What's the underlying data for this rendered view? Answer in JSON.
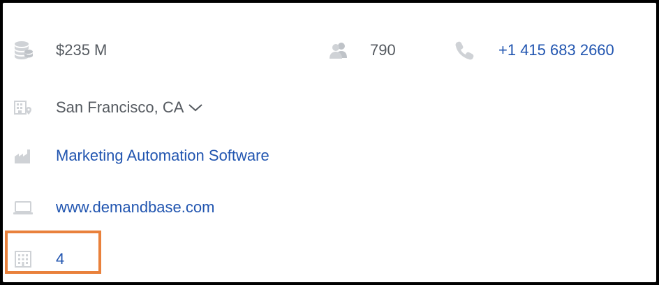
{
  "company": {
    "revenue": {
      "icon": "coins-stack-icon",
      "value": "$235 M"
    },
    "employees": {
      "icon": "people-icon",
      "value": "790"
    },
    "phone": {
      "icon": "phone-icon",
      "value": "+1 415 683 2660"
    },
    "location": {
      "icon": "building-map-pin-icon",
      "value": "San Francisco, CA"
    },
    "industry": {
      "icon": "factory-icon",
      "value": "Marketing Automation Software"
    },
    "website": {
      "icon": "laptop-icon",
      "value": "www.demandbase.com"
    },
    "offices": {
      "icon": "office-building-icon",
      "value": "4"
    }
  },
  "colors": {
    "icon_gray": "#cfd2d6",
    "text_gray": "#555a60",
    "link_blue": "#2155b0",
    "highlight_orange": "#e9813c"
  }
}
